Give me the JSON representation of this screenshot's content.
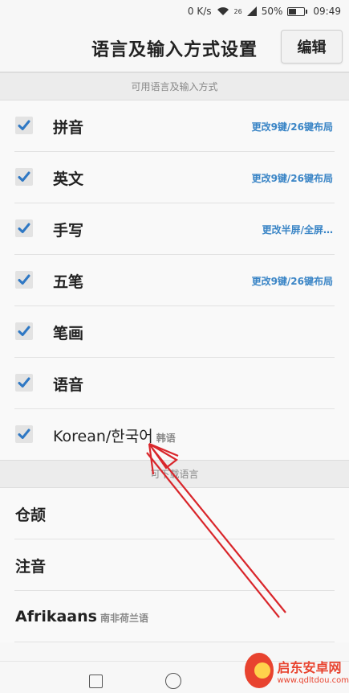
{
  "status": {
    "speed": "0 K/s",
    "network": "26",
    "battery": "50%",
    "time": "09:49",
    "battery_level": 0.5
  },
  "header": {
    "title": "语言及输入方式设置",
    "edit_label": "编辑"
  },
  "available_section": {
    "title": "可用语言及输入方式",
    "items": [
      {
        "label": "拼音",
        "action": "更改9键/26键布局",
        "checked": true
      },
      {
        "label": "英文",
        "action": "更改9键/26键布局",
        "checked": true
      },
      {
        "label": "手写",
        "action": "更改半屏/全屏…",
        "checked": true
      },
      {
        "label": "五笔",
        "action": "更改9键/26键布局",
        "checked": true
      },
      {
        "label": "笔画",
        "action": "",
        "checked": true
      },
      {
        "label": "语音",
        "action": "",
        "checked": true
      },
      {
        "label": "Korean/한국어",
        "sublabel": "韩语",
        "action": "",
        "checked": true
      }
    ]
  },
  "more_section": {
    "title": "可下载语言",
    "items": [
      {
        "label": "仓颉"
      },
      {
        "label": "注音"
      },
      {
        "label": "Afrikaans",
        "sublabel": "南非荷兰语"
      }
    ]
  },
  "watermark": {
    "title": "启东安卓网",
    "url": "www.qdltdou.com"
  },
  "colors": {
    "accent": "#3a85c6",
    "check": "#2f78c4",
    "annotation_arrow": "#d9262b"
  }
}
